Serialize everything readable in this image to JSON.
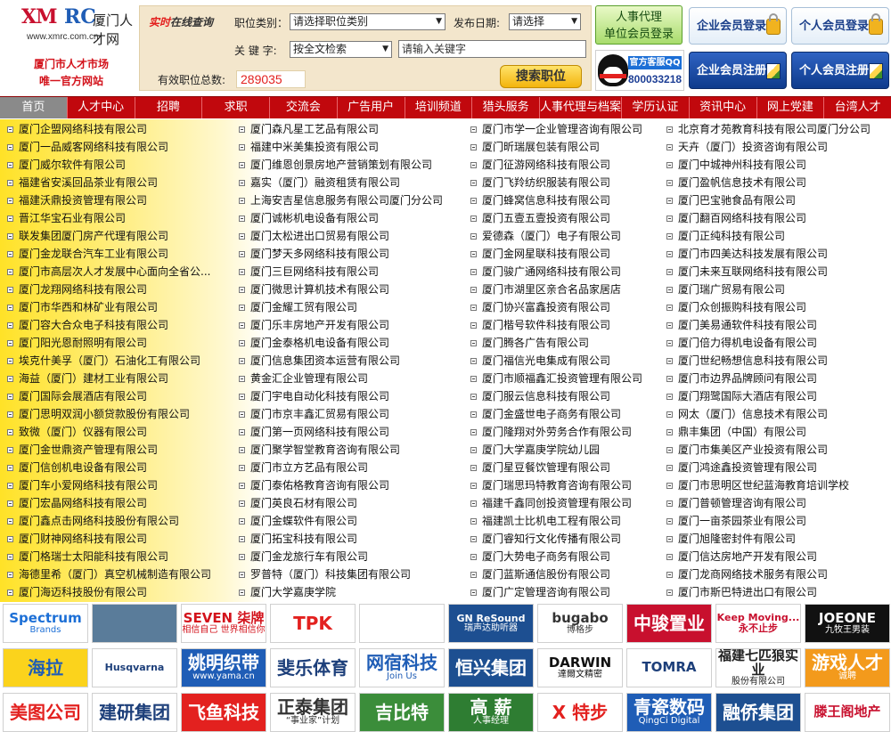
{
  "header": {
    "logo": {
      "brand_a": "XM",
      "brand_b": "RC",
      "cn": "厦门人才网",
      "url": "www.xmrc.com.cn"
    },
    "slogan": [
      "厦门市人才市场",
      "唯一官方网站"
    ]
  },
  "search": {
    "title_red": "实时",
    "title_black": "在线查询",
    "category_label": "职位类别：",
    "category_value": "请选择职位类别",
    "date_label": "发布日期:",
    "date_value": "请选择",
    "keyword_label": "关 键 字:",
    "keyword_scope": "按全文检索",
    "keyword_placeholder": "请输入关键字",
    "total_label": "有效职位总数:",
    "total_value": "289035",
    "button": "搜索职位"
  },
  "side": {
    "agent_btn": [
      "人事代理",
      "单位会员登录"
    ],
    "qq_title": "官方客服QQ",
    "qq_number": "800033218",
    "company_login": "企业会员登录",
    "personal_login": "个人会员登录",
    "company_register": "企业会员注册",
    "personal_register": "个人会员注册"
  },
  "colors": {
    "nav": "#c1080d",
    "accent_red": "#e3211f",
    "count_red": "#e3211f",
    "list_yellow": "#ffe227"
  },
  "nav": [
    "首页",
    "人才中心",
    "招聘",
    "求职",
    "交流会",
    "广告用户",
    "培训频道",
    "猎头服务",
    "人事代理与档案",
    "学历认证",
    "资讯中心",
    "网上党建",
    "台湾人才"
  ],
  "companies": [
    [
      "厦门企盟网络科技有限公司",
      "厦门一品威客网络科技有限公司",
      "厦门威尔软件有限公司",
      "福建省安溪回品茶业有限公司",
      "福建沃鼎投资管理有限公司",
      "晋江华宝石业有限公司",
      "联发集团厦门房产代理有限公司",
      "厦门金龙联合汽车工业有限公司",
      "厦门市高层次人才发展中心面向全省公...",
      "厦门龙翔网络科技有限公司",
      "厦门市华西和林矿业有限公司",
      "厦门容大合众电子科技有限公司",
      "厦门阳光恩耐照明有限公司",
      "埃克什美孚（厦门）石油化工有限公司",
      "海益（厦门）建材工业有限公司",
      "厦门国际会展酒店有限公司",
      "厦门思明双润小额贷款股份有限公司",
      "致微（厦门）仪器有限公司",
      "厦门金世鼎资产管理有限公司",
      "厦门信创机电设备有限公司",
      "厦门车小爱网络科技有限公司",
      "厦门宏晶网络科技有限公司",
      "厦门鑫点击网络科技股份有限公司",
      "厦门财神网络科技有限公司",
      "厦门格瑞士太阳能科技有限公司",
      "海德里希（厦门）真空机械制造有限公司",
      "厦门海迈科技股份有限公司"
    ],
    [
      "厦门森凡星工艺品有限公司",
      "福建中米美集投资有限公司",
      "厦门维恩创景房地产营销策划有限公司",
      "嘉实（厦门）融资租赁有限公司",
      "上海安吉星信息服务有限公司厦门分公司",
      "厦门诚彬机电设备有限公司",
      "厦门太松进出口贸易有限公司",
      "厦门梦天多网络科技有限公司",
      "厦门三巨网络科技有限公司",
      "厦门微思计算机技术有限公司",
      "厦门金耀工贸有限公司",
      "厦门乐丰房地产开发有限公司",
      "厦门金泰格机电设备有限公司",
      "厦门信息集团资本运营有限公司",
      "黄金汇企业管理有限公司",
      "厦门宇电自动化科技有限公司",
      "厦门市京丰鑫汇贸易有限公司",
      "厦门第一页网络科技有限公司",
      "厦门聚学智堂教育咨询有限公司",
      "厦门市立方艺品有限公司",
      "厦门泰佑格教育咨询有限公司",
      "厦门英良石材有限公司",
      "厦门金蝶软件有限公司",
      "厦门拓宝科技有限公司",
      "厦门金龙旅行车有限公司",
      "罗普特（厦门）科技集团有限公司",
      "厦门大学嘉庚学院"
    ],
    [
      "厦门市学一企业管理咨询有限公司",
      "厦门昕瑞展包装有限公司",
      "厦门征游网络科技有限公司",
      "厦门飞羚纺织服装有限公司",
      "厦门蜂窝信息科技有限公司",
      "厦门五壹五壹投资有限公司",
      "爱德森（厦门）电子有限公司",
      "厦门金网星联科技有限公司",
      "厦门骏广通网络科技有限公司",
      "厦门市湖里区亲合名品家居店",
      "厦门协兴富鑫投资有限公司",
      "厦门楷号软件科技有限公司",
      "厦门腾各广告有限公司",
      "厦门福信光电集成有限公司",
      "厦门市顺福鑫汇投资管理有限公司",
      "厦门服云信息科技有限公司",
      "厦门金盛世电子商务有限公司",
      "厦门隆翔对外劳务合作有限公司",
      "厦门大学嘉庚学院幼儿园",
      "厦门星豆餐饮管理有限公司",
      "厦门瑞思玛特教育咨询有限公司",
      "福建千鑫同创投资管理有限公司",
      "福建凯士比机电工程有限公司",
      "厦门睿知行文化传播有限公司",
      "厦门大势电子商务有限公司",
      "厦门蓝斯通信股份有限公司",
      "厦门广定管理咨询有限公司"
    ],
    [
      "北京育才苑教育科技有限公司厦门分公司",
      "天卉（厦门）投资咨询有限公司",
      "厦门中城神州科技有限公司",
      "厦门盈帆信息技术有限公司",
      "厦门巴宝驰食品有限公司",
      "厦门翻百网络科技有限公司",
      "厦门正纯科技有限公司",
      "厦门市四美达科技发展有限公司",
      "厦门未来互联网络科技有限公司",
      "厦门瑞广贸易有限公司",
      "厦门众创振购科技有限公司",
      "厦门美易通软件科技有限公司",
      "厦门倍力得机电设备有限公司",
      "厦门世纪畅想信息科技有限公司",
      "厦门市边界品牌顾问有限公司",
      "厦门翔鹭国际大酒店有限公司",
      "网太（厦门）信息技术有限公司",
      "鼎丰集团（中国）有限公司",
      "厦门市集美区产业投资有限公司",
      "厦门鸿途鑫投资管理有限公司",
      "厦门市思明区世纪蓝海教育培训学校",
      "厦门普顿管理咨询有限公司",
      "厦门一亩茶园茶业有限公司",
      "厦门旭隆密封件有限公司",
      "厦门信达房地产开发有限公司",
      "厦门龙商网络技术服务有限公司",
      "厦门市斯巴特进出口有限公司"
    ]
  ],
  "logos": [
    [
      {
        "id": "spectrum",
        "text": "Spectrum",
        "sub": "Brands",
        "fg": "#1c6fd6",
        "bg": "#ffffff"
      },
      {
        "id": "ship",
        "text": "",
        "sub": "",
        "fg": "#ffffff",
        "bg": "#5a7c9a"
      },
      {
        "id": "seven",
        "text": "SEVEN 柒牌",
        "sub": "相信自己 世界相信你",
        "fg": "#d3121b",
        "bg": "#ffffff"
      },
      {
        "id": "tpk",
        "text": "TPK",
        "sub": "",
        "fg": "#e3211f",
        "bg": "#ffffff"
      },
      {
        "id": "orb",
        "text": "",
        "sub": "",
        "fg": "#e3211f",
        "bg": "#ffffff"
      },
      {
        "id": "resound",
        "text": "GN ReSound",
        "sub": "瑞声达助听器",
        "fg": "#ffffff",
        "bg": "#1d4f91"
      },
      {
        "id": "bugabo",
        "text": "bugabo",
        "sub": "博格步",
        "fg": "#333333",
        "bg": "#ffffff"
      },
      {
        "id": "zhongjun",
        "text": "中骏置业",
        "sub": "",
        "fg": "#ffffff",
        "bg": "#c8102e"
      },
      {
        "id": "anta",
        "text": "Keep Moving...永不止步",
        "sub": "",
        "fg": "#c8102e",
        "bg": "#ffffff"
      },
      {
        "id": "joeone",
        "text": "JOEONE",
        "sub": "九牧王男装",
        "fg": "#ffffff",
        "bg": "#111111"
      }
    ],
    [
      {
        "id": "haila",
        "text": "海拉",
        "sub": "",
        "fg": "#1f5db6",
        "bg": "#fbd31c"
      },
      {
        "id": "husqvarna",
        "text": "Husqvarna",
        "sub": "",
        "fg": "#1d3f7a",
        "bg": "#ffffff"
      },
      {
        "id": "yaming",
        "text": "姚明织带",
        "sub": "www.yama.cn",
        "fg": "#ffffff",
        "bg": "#1f5db6"
      },
      {
        "id": "feile",
        "text": "斐乐体育",
        "sub": "",
        "fg": "#1d3f7a",
        "bg": "#ffffff"
      },
      {
        "id": "wangsu",
        "text": "网宿科技",
        "sub": "Join Us",
        "fg": "#1f5db6",
        "bg": "#ffffff"
      },
      {
        "id": "hengxing",
        "text": "恒兴集团",
        "sub": "",
        "fg": "#ffffff",
        "bg": "#1d4f91"
      },
      {
        "id": "darwin",
        "text": "DARWIN",
        "sub": "達爾文精密",
        "fg": "#111111",
        "bg": "#ffffff"
      },
      {
        "id": "tomra",
        "text": "TOMRA",
        "sub": "",
        "fg": "#1d3f7a",
        "bg": "#ffffff"
      },
      {
        "id": "qipi",
        "text": "福建七匹狼实业",
        "sub": "股份有限公司",
        "fg": "#222222",
        "bg": "#ffffff"
      },
      {
        "id": "game",
        "text": "游戏人才",
        "sub": "诚聘",
        "fg": "#ffffff",
        "bg": "#f39a1c"
      }
    ],
    [
      {
        "id": "meiguo",
        "text": "美图公司",
        "sub": "",
        "fg": "#e3211f",
        "bg": "#ffffff"
      },
      {
        "id": "jianyan",
        "text": "建研集团",
        "sub": "",
        "fg": "#1d3f7a",
        "bg": "#ffffff"
      },
      {
        "id": "feiyu",
        "text": "飞鱼科技",
        "sub": "",
        "fg": "#ffffff",
        "bg": "#e3211f"
      },
      {
        "id": "zhengtai",
        "text": "正泰集团",
        "sub": "“事业家”计划",
        "fg": "#333333",
        "bg": "#ffffff"
      },
      {
        "id": "jibite",
        "text": "吉比特",
        "sub": "",
        "fg": "#ffffff",
        "bg": "#3b8d3a"
      },
      {
        "id": "gaoxin",
        "text": "高 薪",
        "sub": "人事经理",
        "fg": "#ffffff",
        "bg": "#2e7d32"
      },
      {
        "id": "xtep",
        "text": "X 特步",
        "sub": "",
        "fg": "#e3211f",
        "bg": "#ffffff"
      },
      {
        "id": "qingci",
        "text": "青瓷数码",
        "sub": "QingCi Digital",
        "fg": "#ffffff",
        "bg": "#1f5db6"
      },
      {
        "id": "rongqiao",
        "text": "融侨集团",
        "sub": "",
        "fg": "#ffffff",
        "bg": "#1d4f91"
      },
      {
        "id": "tengwang",
        "text": "滕王阁地产",
        "sub": "",
        "fg": "#c8102e",
        "bg": "#ffffff"
      }
    ]
  ]
}
